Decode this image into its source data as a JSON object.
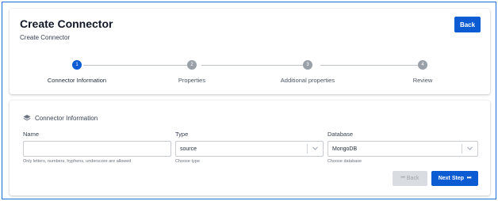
{
  "header": {
    "title": "Create Connector",
    "subtitle": "Create Connector",
    "back_label": "Back"
  },
  "stepper": {
    "steps": [
      {
        "number": "1",
        "label": "Connector Information",
        "active": true
      },
      {
        "number": "2",
        "label": "Properties",
        "active": false
      },
      {
        "number": "3",
        "label": "Additional properties",
        "active": false
      },
      {
        "number": "4",
        "label": "Review",
        "active": false
      }
    ]
  },
  "section": {
    "icon": "layers-icon",
    "title": "Connector Information"
  },
  "form": {
    "name": {
      "label": "Name",
      "value": "",
      "helper": "Only letters, numbers, hyphens, underscore are allowed"
    },
    "type": {
      "label": "Type",
      "value": "source",
      "helper": "Choose type"
    },
    "database": {
      "label": "Database",
      "value": "MongoDB",
      "helper": "Choose database"
    }
  },
  "actions": {
    "back_label": "Back",
    "next_label": "Next Step"
  },
  "colors": {
    "primary": "#0b5bd3",
    "frame_border": "#1f6fd6",
    "inactive_step": "#9aa0a8",
    "disabled_button": "#d9dce0"
  }
}
